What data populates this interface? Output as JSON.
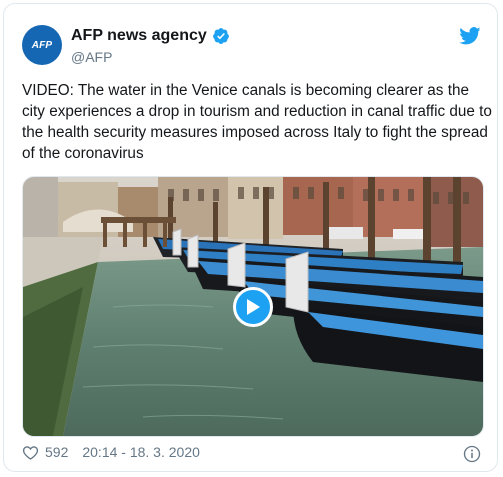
{
  "author": {
    "display_name": "AFP news agency",
    "handle": "@AFP",
    "avatar_text": "AFP"
  },
  "tweet": {
    "text": "VIDEO: The water in the Venice canals is becoming clearer as the city experiences a drop in tourism and reduction in canal traffic due to the health security measures imposed across Italy to fight the spread of the coronavirus"
  },
  "footer": {
    "likes": "592",
    "timestamp": "20:14 - 18. 3. 2020"
  },
  "icons": {
    "verified": "verified-badge-icon",
    "brand": "twitter-bird-icon",
    "like": "heart-icon",
    "info": "info-icon",
    "play": "play-icon"
  },
  "colors": {
    "brand": "#1da1f2",
    "avatar": "#1667b3",
    "text": "#14171a",
    "muted": "#657786",
    "border": "#e1e8ed"
  }
}
